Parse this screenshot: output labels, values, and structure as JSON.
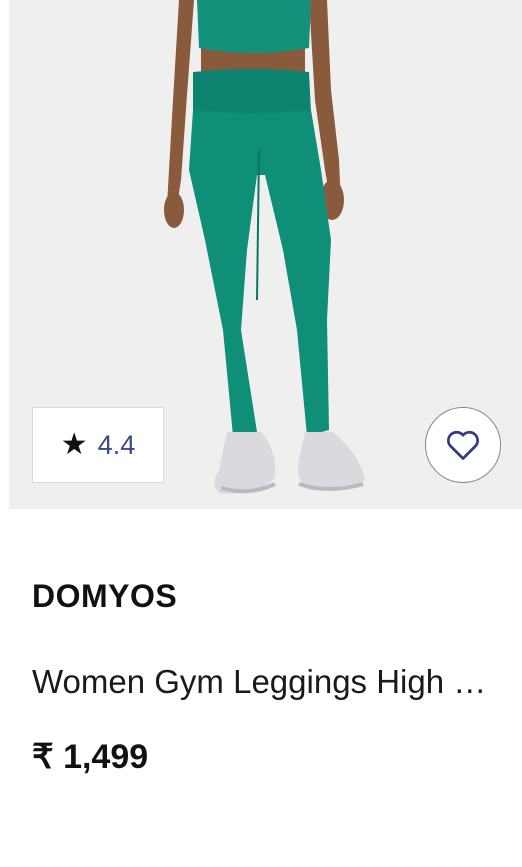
{
  "product": {
    "brand": "DOMYOS",
    "title": "Women Gym Leggings High …",
    "price": "₹ 1,499",
    "rating": {
      "value": "4.4",
      "icon": "star-icon"
    },
    "wishlist_icon": "heart-outline-icon",
    "colors": {
      "leggings": "#0f8f78",
      "rating_text": "#3a4a8c",
      "background": "#efefef"
    }
  }
}
